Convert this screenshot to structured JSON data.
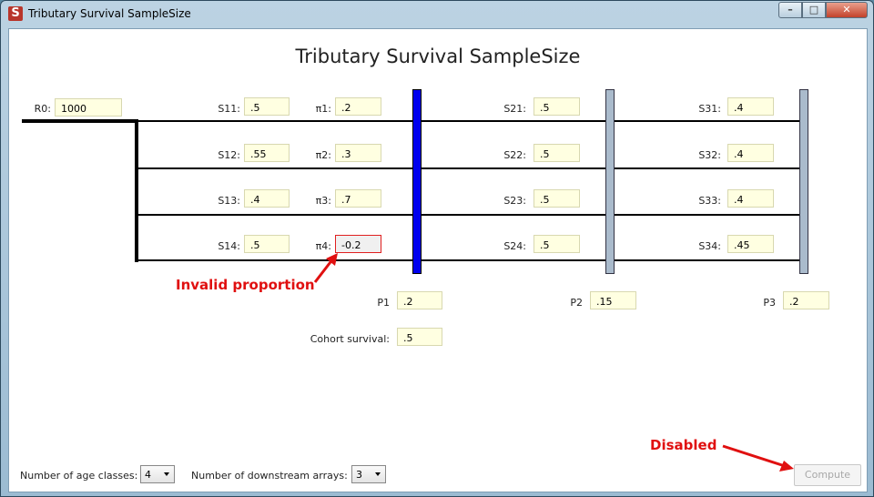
{
  "window": {
    "title": "Tributary Survival SampleSize",
    "icon_letter": "S"
  },
  "heading": "Tributary Survival SampleSize",
  "r0": {
    "label": "R0:",
    "value": "1000"
  },
  "array1": [
    {
      "s_label": "S11:",
      "s_value": ".5",
      "pi_label": "π1:",
      "pi_value": ".2"
    },
    {
      "s_label": "S12:",
      "s_value": ".55",
      "pi_label": "π2:",
      "pi_value": ".3"
    },
    {
      "s_label": "S13:",
      "s_value": ".4",
      "pi_label": "π3:",
      "pi_value": ".7"
    },
    {
      "s_label": "S14:",
      "s_value": ".5",
      "pi_label": "π4:",
      "pi_value": "-0.2"
    }
  ],
  "array2": [
    {
      "label": "S21:",
      "value": ".5"
    },
    {
      "label": "S22:",
      "value": ".5"
    },
    {
      "label": "S23:",
      "value": ".5"
    },
    {
      "label": "S24:",
      "value": ".5"
    }
  ],
  "array3": [
    {
      "label": "S31:",
      "value": ".4"
    },
    {
      "label": "S32:",
      "value": ".4"
    },
    {
      "label": "S33:",
      "value": ".4"
    },
    {
      "label": "S34:",
      "value": ".45"
    }
  ],
  "p": [
    {
      "label": "P1",
      "value": ".2"
    },
    {
      "label": "P2",
      "value": ".15"
    },
    {
      "label": "P3",
      "value": ".2"
    }
  ],
  "cohort": {
    "label": "Cohort survival:",
    "value": ".5"
  },
  "annotations": {
    "invalid": "Invalid proportion",
    "disabled": "Disabled",
    "color": "#e01010"
  },
  "footer": {
    "age_classes_label": "Number of age classes:",
    "age_classes_value": "4",
    "downstream_label": "Number of downstream arrays:",
    "downstream_value": "3",
    "compute_label": "Compute"
  },
  "colors": {
    "field_bg": "#ffffe1",
    "array1_bar": "#0000ee",
    "array_bar": "#aabbcc"
  }
}
